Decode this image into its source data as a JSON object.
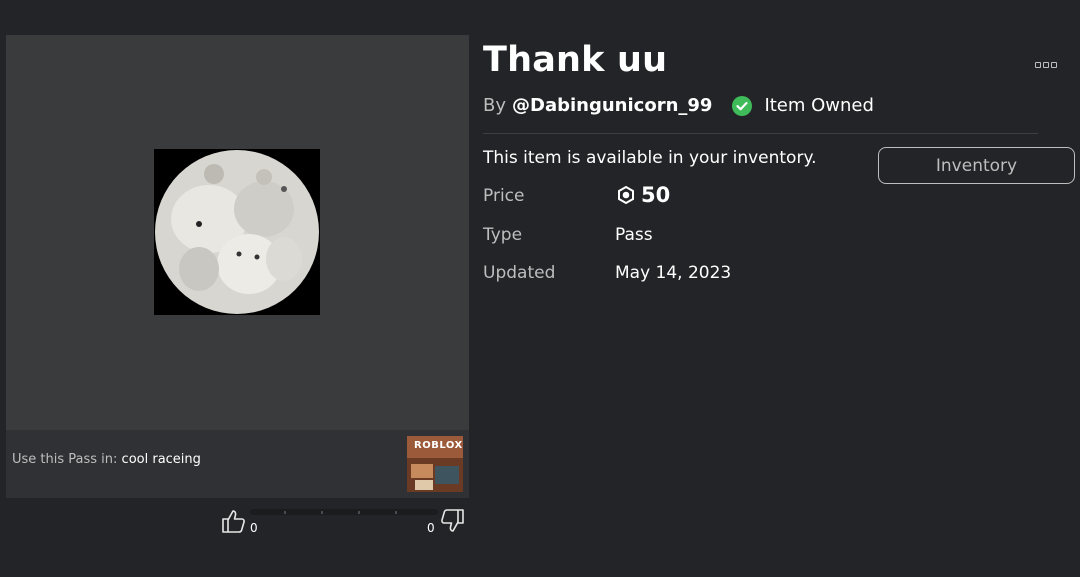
{
  "item": {
    "title": "Thank uu",
    "by_label": "By",
    "creator": "@Dabingunicorn_99",
    "owned_label": "Item Owned",
    "available_text": "This item is available in your inventory.",
    "inventory_button": "Inventory"
  },
  "details": {
    "price_label": "Price",
    "price_value": "50",
    "type_label": "Type",
    "type_value": "Pass",
    "updated_label": "Updated",
    "updated_value": "May 14, 2023"
  },
  "use_in": {
    "label": "Use this Pass in:",
    "game_name": "cool raceing",
    "game_logo_text": "ROBLOX"
  },
  "votes": {
    "up_count": "0",
    "down_count": "0"
  },
  "icons": {
    "owned": "check-circle-icon",
    "price": "robux-icon",
    "more": "more-options-icon",
    "up": "thumbs-up-icon",
    "down": "thumbs-down-icon"
  },
  "colors": {
    "background": "#232427",
    "panel": "#393b3d",
    "owned_green": "#3fbb5a",
    "muted_text": "#bdbebe",
    "game_thumb": "#9b5a3a"
  }
}
